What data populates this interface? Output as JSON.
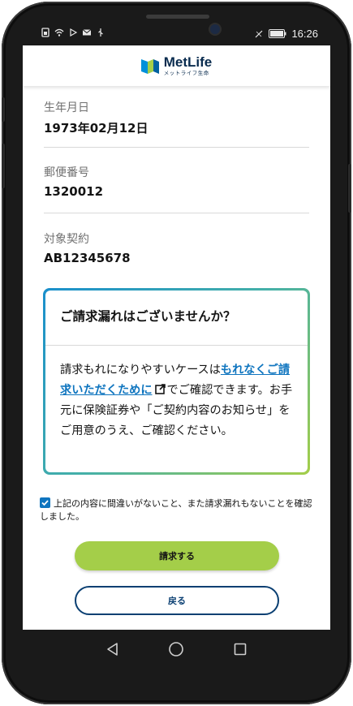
{
  "status_bar": {
    "time": "16:26"
  },
  "app_bar": {
    "logo_name": "MetLife",
    "logo_sub": "メットライフ生命"
  },
  "fields": [
    {
      "label": "生年月日",
      "value": "1973年02月12日"
    },
    {
      "label": "郵便番号",
      "value": "1320012"
    },
    {
      "label": "対象契約",
      "value": "AB12345678"
    }
  ],
  "notice": {
    "title": "ご請求漏れはございませんか？",
    "body_prefix": "請求もれになりやすいケースは",
    "link_text": "もれなくご請求いただくために",
    "body_suffix": "でご確認できます。お手元に保険証券や「ご契約内容のお知らせ」をご用意のうえ、ご確認ください。"
  },
  "confirm": {
    "checked": true,
    "text": "上記の内容に間違いがないこと、また請求漏れもないことを確認しました。"
  },
  "buttons": {
    "submit_label": "請求する",
    "back_label": "戻る"
  },
  "colors": {
    "brand_navy": "#0a2c4f",
    "link_blue": "#0f75bf",
    "accent_green": "#a4ce49",
    "back_border": "#0a3f72"
  },
  "icons": {
    "external_link": "external-link-icon",
    "nav_back": "nav-back-icon",
    "nav_home": "nav-home-icon",
    "nav_recents": "nav-recents-icon"
  }
}
